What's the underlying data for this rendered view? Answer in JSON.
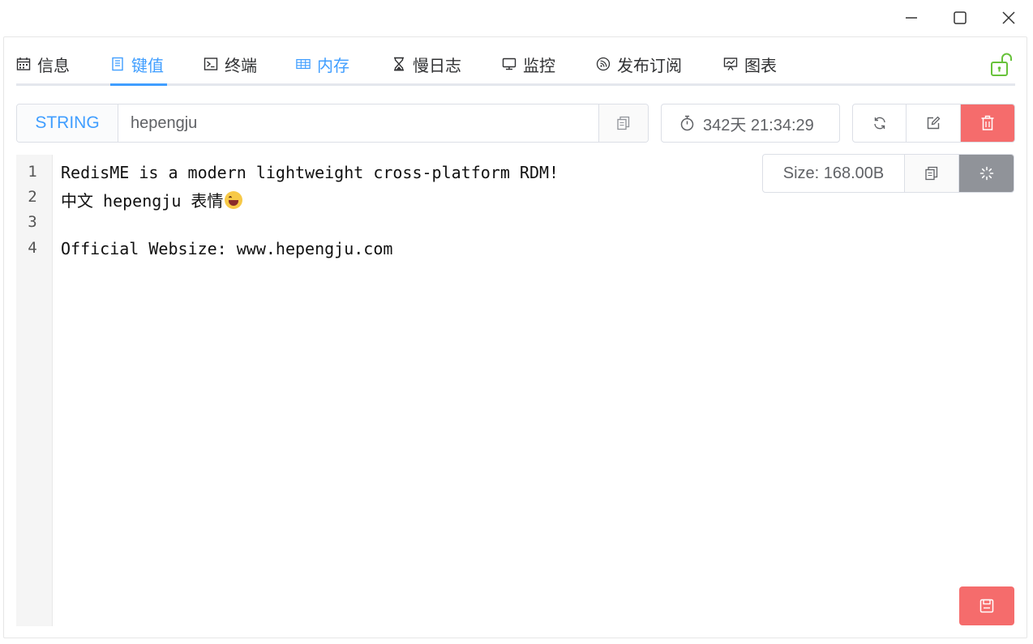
{
  "window": {
    "controls": [
      {
        "name": "minimize-icon"
      },
      {
        "name": "maximize-icon"
      },
      {
        "name": "close-icon"
      }
    ]
  },
  "tabs": [
    {
      "label": "信息",
      "icon": "calendar-icon",
      "active": false
    },
    {
      "label": "键值",
      "icon": "document-icon",
      "active": true
    },
    {
      "label": "终端",
      "icon": "terminal-icon",
      "active": false
    },
    {
      "label": "内存",
      "icon": "table-icon",
      "active": false
    },
    {
      "label": "慢日志",
      "icon": "hourglass-icon",
      "active": false
    },
    {
      "label": "监控",
      "icon": "monitor-icon",
      "active": false
    },
    {
      "label": "发布订阅",
      "icon": "rss-icon",
      "active": false
    },
    {
      "label": "图表",
      "icon": "chart-icon",
      "active": false
    }
  ],
  "key": {
    "type": "STRING",
    "name": "hepengju",
    "ttl": "342天 21:34:29"
  },
  "editor": {
    "lines": [
      {
        "num": "1",
        "text": "RedisME is a modern lightweight cross-platform RDM!"
      },
      {
        "num": "2",
        "text": "中文 hepengju 表情",
        "emoji": "grinning-face-emoji"
      },
      {
        "num": "3",
        "text": ""
      },
      {
        "num": "4",
        "text": "Official Websize: www.hepengju.com"
      }
    ],
    "size": "Size: 168.00B"
  },
  "colors": {
    "accent": "#409eff",
    "danger": "#f56c6c",
    "loading": "#909399",
    "unlock": "#67c23a"
  }
}
